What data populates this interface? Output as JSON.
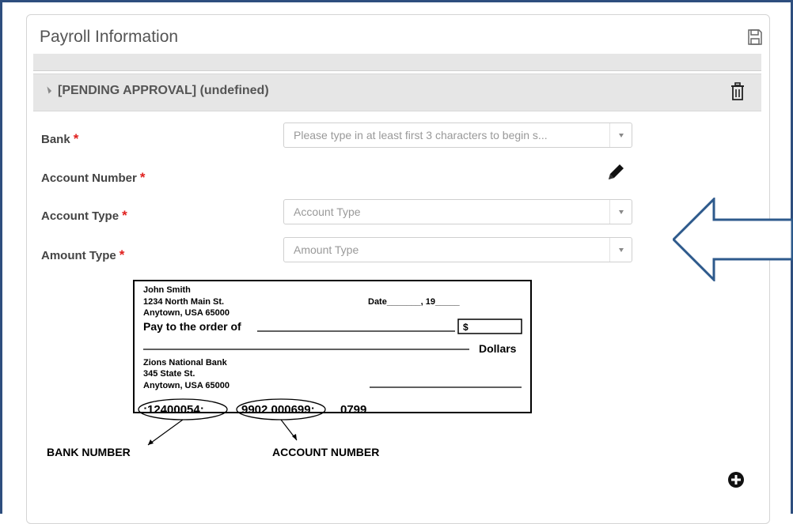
{
  "panel": {
    "title": "Payroll Information"
  },
  "section": {
    "title": "[PENDING APPROVAL] (undefined)"
  },
  "fields": {
    "bank": {
      "label": "Bank",
      "required": "*",
      "placeholder": "Please type in at least first 3 characters to begin s..."
    },
    "account_number": {
      "label": "Account Number",
      "required": "*"
    },
    "account_type": {
      "label": "Account Type",
      "required": "*",
      "placeholder": "Account Type"
    },
    "amount_type": {
      "label": "Amount Type",
      "required": "*",
      "placeholder": "Amount Type"
    }
  },
  "check": {
    "name": "John Smith",
    "address1": "1234 North Main St.",
    "address2": "Anytown, USA 65000",
    "date_label": "Date_______, 19_____",
    "pay_to": "Pay to the order of",
    "dollar_sign": "$",
    "dollars": "Dollars",
    "bank_name": "Zions National Bank",
    "bank_address1": "345 State St.",
    "bank_address2": "Anytown, USA 65000",
    "routing": ":12400054:",
    "account": "9902 000699:",
    "check_no": "0799",
    "bank_number_caption": "BANK NUMBER",
    "account_number_caption": "ACCOUNT NUMBER"
  },
  "icons": {
    "save": "save-icon",
    "trash": "trash-icon",
    "edit": "pencil-icon",
    "add": "plus-circle-icon",
    "caret": "collapse-caret-icon",
    "dropdown": "chevron-down-icon"
  },
  "colors": {
    "frame_border": "#2e4e7e",
    "required": "#e0201e",
    "arrow": "#2e5a8c"
  }
}
